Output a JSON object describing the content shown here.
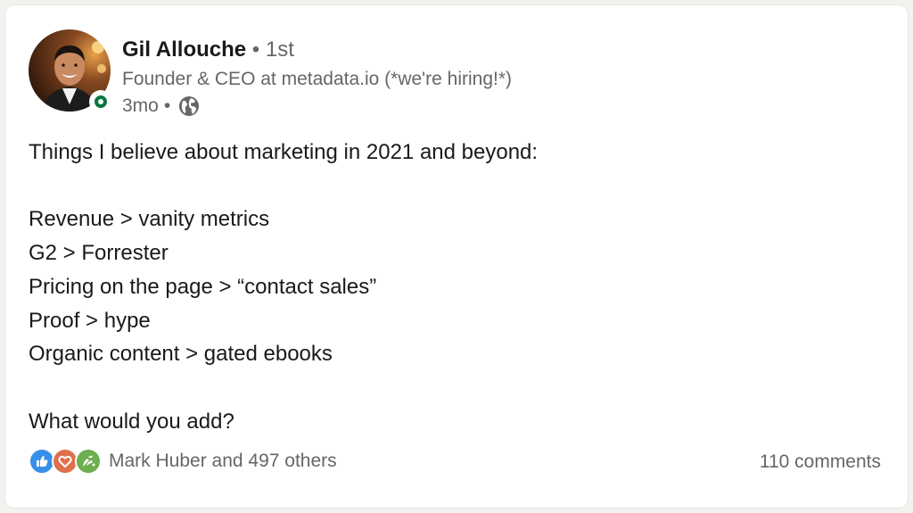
{
  "author": {
    "name": "Gil Allouche",
    "degree": "• 1st",
    "headline": "Founder & CEO at metadata.io (*we're hiring!*)",
    "time": "3mo",
    "time_separator": "•",
    "visibility_icon": "globe-icon",
    "online_status_color": "#057642"
  },
  "post": {
    "lines": [
      "Things I believe about marketing in 2021 and beyond:",
      "",
      "Revenue > vanity metrics",
      "G2 > Forrester",
      "Pricing on the page > “contact sales”",
      "Proof > hype",
      "Organic content > gated ebooks",
      "",
      "What would you add?"
    ]
  },
  "social": {
    "reaction_icons": [
      "like-icon",
      "love-icon",
      "celebrate-icon"
    ],
    "reaction_colors": {
      "like": "#378fe9",
      "love": "#df704d",
      "celebrate": "#6dae4f"
    },
    "reactions_text": "Mark Huber and 497 others",
    "comments_text": "110 comments"
  }
}
